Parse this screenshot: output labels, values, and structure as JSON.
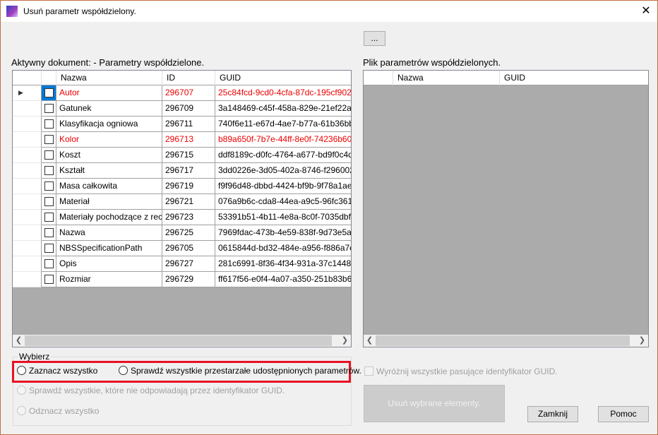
{
  "window": {
    "title": "Usuń parametr współdzielony.",
    "close": "✕"
  },
  "browse_button": "...",
  "left": {
    "label": "Aktywny dokument: - Parametry współdzielone.",
    "columns": [
      "Nazwa",
      "ID",
      "GUID"
    ],
    "rows": [
      {
        "name": "Autor",
        "id": "296707",
        "guid": "25c84fcd-9cd0-4cfa-87dc-195cf9029c...",
        "red": true
      },
      {
        "name": "Gatunek",
        "id": "296709",
        "guid": "3a148469-c45f-458a-829e-21ef22a5cf2",
        "red": false
      },
      {
        "name": "Klasyfikacja ogniowa",
        "id": "296711",
        "guid": "740f6e11-e67d-4ae7-b77a-61b36bb37...",
        "red": false
      },
      {
        "name": "Kolor",
        "id": "296713",
        "guid": "b89a650f-7b7e-44ff-8e0f-74236b60969",
        "red": true
      },
      {
        "name": "Koszt",
        "id": "296715",
        "guid": "ddf8189c-d0fc-4764-a677-bd9f0c4d6a...",
        "red": false
      },
      {
        "name": "Kształt",
        "id": "296717",
        "guid": "3dd0226e-3d05-402a-8746-f29600267...",
        "red": false
      },
      {
        "name": "Masa całkowita",
        "id": "296719",
        "guid": "f9f96d48-dbbd-4424-bf9b-9f78a1aed5d",
        "red": false
      },
      {
        "name": "Materiał",
        "id": "296721",
        "guid": "076a9b6c-cda8-44ea-a9c5-96fc3614b...",
        "red": false
      },
      {
        "name": "Materiały pochodzące z rec...",
        "id": "296723",
        "guid": "53391b51-4b11-4e8a-8c0f-7035dbf45...",
        "red": false
      },
      {
        "name": "Nazwa",
        "id": "296725",
        "guid": "7969fdac-473b-4e59-838f-9d73e5a74...",
        "red": false
      },
      {
        "name": "NBSSpecificationPath",
        "id": "296705",
        "guid": "0615844d-bd32-484e-a956-f886a7e3f...",
        "red": false
      },
      {
        "name": "Opis",
        "id": "296727",
        "guid": "281c6991-8f36-4f34-931a-37c14484e...",
        "red": false
      },
      {
        "name": "Rozmiar",
        "id": "296729",
        "guid": "ff617f56-e0f4-4a07-a350-251b83b6a0d",
        "red": false
      }
    ]
  },
  "right": {
    "label": "Plik parametrów współdzielonych.",
    "columns": [
      "Nazwa",
      "GUID"
    ]
  },
  "select_group": {
    "title": "Wybierz",
    "options": [
      "Zaznacz wszystko",
      "Sprawdź wszystkie przestarzałe udostępnionych parametrów.",
      "Sprawdź wszystkie, które nie odpowiadają przez identyfikator GUID.",
      "Odznacz wszystko"
    ]
  },
  "highlight_guid_checkbox": "Wyróżnij wszystkie pasujące identyfikator GUID.",
  "delete_button": "Usuń wybrane elementy.",
  "close_button": "Zamknij",
  "help_button": "Pomoc",
  "colors": {
    "highlight_box": "#e81123",
    "red_text": "#ee0000",
    "selected_cell": "#0078d7"
  }
}
